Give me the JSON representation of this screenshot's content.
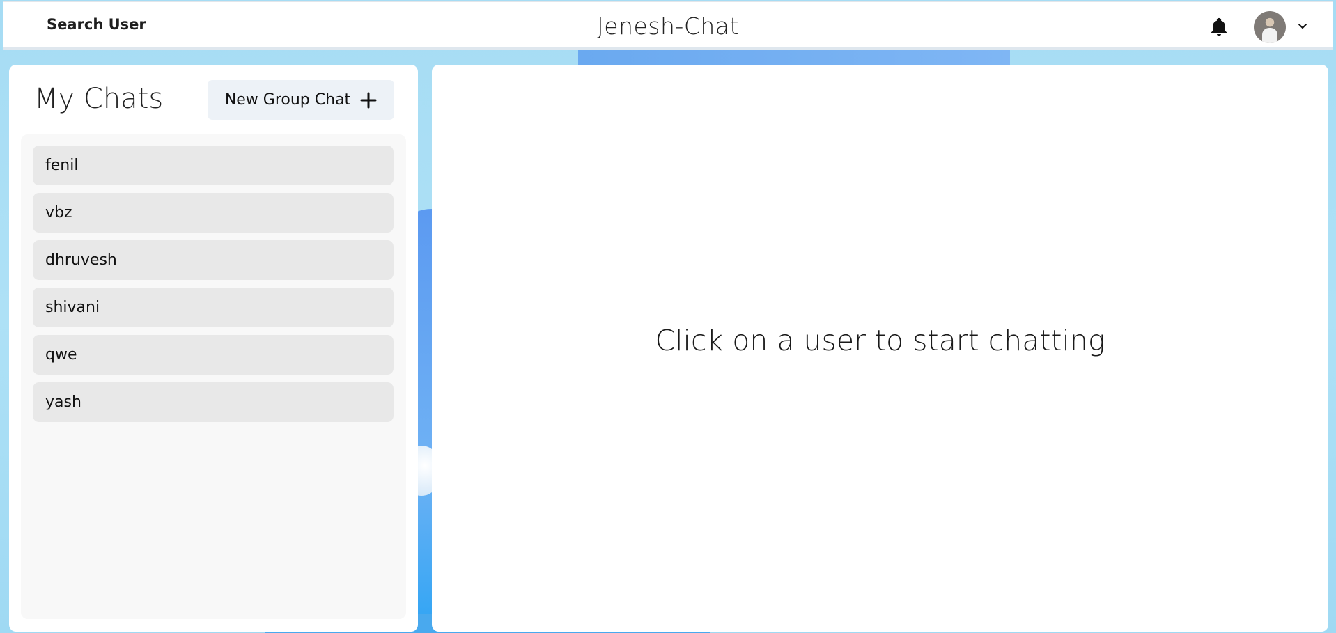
{
  "header": {
    "search_label": "Search User",
    "app_title": "Jenesh-Chat",
    "icons": {
      "notification": "bell-icon",
      "avatar": "avatar",
      "menu": "chevron-down-icon"
    }
  },
  "sidebar": {
    "title": "My Chats",
    "new_group_label": "New Group Chat",
    "new_group_icon": "plus-icon",
    "chats": [
      {
        "name": "fenil"
      },
      {
        "name": "vbz"
      },
      {
        "name": "dhruvesh"
      },
      {
        "name": "shivani"
      },
      {
        "name": "qwe"
      },
      {
        "name": "yash"
      }
    ]
  },
  "main": {
    "empty_message": "Click on a user to start chatting"
  },
  "colors": {
    "background": "#a6dcf4",
    "panel": "#ffffff",
    "chat_list_bg": "#f8f8f8",
    "chat_item_bg": "#e8e8e8",
    "button_bg": "#edf2f7"
  }
}
